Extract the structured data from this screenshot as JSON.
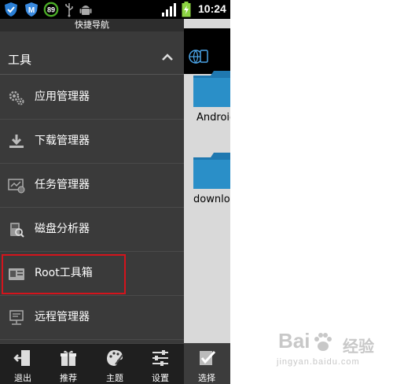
{
  "status_bar": {
    "battery_ring_value": "89",
    "time": "10:24"
  },
  "drawer": {
    "title": "快捷导航",
    "section_label": "工具",
    "items": [
      {
        "label": "应用管理器",
        "icon": "gears-icon"
      },
      {
        "label": "下载管理器",
        "icon": "download-icon"
      },
      {
        "label": "任务管理器",
        "icon": "task-manager-icon"
      },
      {
        "label": "磁盘分析器",
        "icon": "disk-analyzer-icon"
      },
      {
        "label": "Root工具箱",
        "icon": "root-toolbox-icon"
      },
      {
        "label": "远程管理器",
        "icon": "remote-manager-icon"
      }
    ],
    "highlight_color": "#d4141c"
  },
  "file_panel": {
    "items": [
      {
        "name": "Android"
      },
      {
        "name": "download"
      }
    ],
    "folder_color": "#2a8fc8"
  },
  "bottom_bar": {
    "exit": "退出",
    "recommend": "推荐",
    "theme": "主题",
    "settings": "设置",
    "select": "选择"
  },
  "watermark": {
    "brand": "Bai",
    "suffix": "经验",
    "url": "jingyan.baidu.com"
  }
}
